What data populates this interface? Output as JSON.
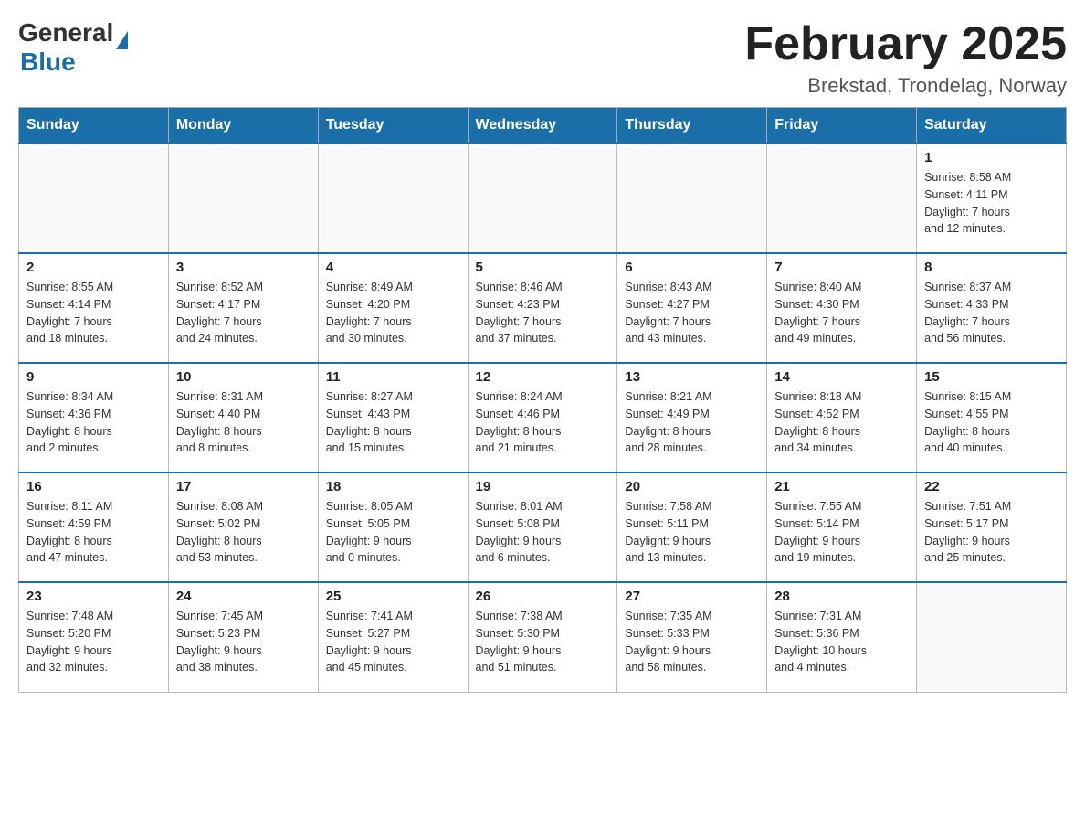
{
  "header": {
    "logo_general": "General",
    "logo_blue": "Blue",
    "month_title": "February 2025",
    "location": "Brekstad, Trondelag, Norway"
  },
  "weekdays": [
    "Sunday",
    "Monday",
    "Tuesday",
    "Wednesday",
    "Thursday",
    "Friday",
    "Saturday"
  ],
  "weeks": [
    [
      {
        "day": "",
        "info": ""
      },
      {
        "day": "",
        "info": ""
      },
      {
        "day": "",
        "info": ""
      },
      {
        "day": "",
        "info": ""
      },
      {
        "day": "",
        "info": ""
      },
      {
        "day": "",
        "info": ""
      },
      {
        "day": "1",
        "info": "Sunrise: 8:58 AM\nSunset: 4:11 PM\nDaylight: 7 hours\nand 12 minutes."
      }
    ],
    [
      {
        "day": "2",
        "info": "Sunrise: 8:55 AM\nSunset: 4:14 PM\nDaylight: 7 hours\nand 18 minutes."
      },
      {
        "day": "3",
        "info": "Sunrise: 8:52 AM\nSunset: 4:17 PM\nDaylight: 7 hours\nand 24 minutes."
      },
      {
        "day": "4",
        "info": "Sunrise: 8:49 AM\nSunset: 4:20 PM\nDaylight: 7 hours\nand 30 minutes."
      },
      {
        "day": "5",
        "info": "Sunrise: 8:46 AM\nSunset: 4:23 PM\nDaylight: 7 hours\nand 37 minutes."
      },
      {
        "day": "6",
        "info": "Sunrise: 8:43 AM\nSunset: 4:27 PM\nDaylight: 7 hours\nand 43 minutes."
      },
      {
        "day": "7",
        "info": "Sunrise: 8:40 AM\nSunset: 4:30 PM\nDaylight: 7 hours\nand 49 minutes."
      },
      {
        "day": "8",
        "info": "Sunrise: 8:37 AM\nSunset: 4:33 PM\nDaylight: 7 hours\nand 56 minutes."
      }
    ],
    [
      {
        "day": "9",
        "info": "Sunrise: 8:34 AM\nSunset: 4:36 PM\nDaylight: 8 hours\nand 2 minutes."
      },
      {
        "day": "10",
        "info": "Sunrise: 8:31 AM\nSunset: 4:40 PM\nDaylight: 8 hours\nand 8 minutes."
      },
      {
        "day": "11",
        "info": "Sunrise: 8:27 AM\nSunset: 4:43 PM\nDaylight: 8 hours\nand 15 minutes."
      },
      {
        "day": "12",
        "info": "Sunrise: 8:24 AM\nSunset: 4:46 PM\nDaylight: 8 hours\nand 21 minutes."
      },
      {
        "day": "13",
        "info": "Sunrise: 8:21 AM\nSunset: 4:49 PM\nDaylight: 8 hours\nand 28 minutes."
      },
      {
        "day": "14",
        "info": "Sunrise: 8:18 AM\nSunset: 4:52 PM\nDaylight: 8 hours\nand 34 minutes."
      },
      {
        "day": "15",
        "info": "Sunrise: 8:15 AM\nSunset: 4:55 PM\nDaylight: 8 hours\nand 40 minutes."
      }
    ],
    [
      {
        "day": "16",
        "info": "Sunrise: 8:11 AM\nSunset: 4:59 PM\nDaylight: 8 hours\nand 47 minutes."
      },
      {
        "day": "17",
        "info": "Sunrise: 8:08 AM\nSunset: 5:02 PM\nDaylight: 8 hours\nand 53 minutes."
      },
      {
        "day": "18",
        "info": "Sunrise: 8:05 AM\nSunset: 5:05 PM\nDaylight: 9 hours\nand 0 minutes."
      },
      {
        "day": "19",
        "info": "Sunrise: 8:01 AM\nSunset: 5:08 PM\nDaylight: 9 hours\nand 6 minutes."
      },
      {
        "day": "20",
        "info": "Sunrise: 7:58 AM\nSunset: 5:11 PM\nDaylight: 9 hours\nand 13 minutes."
      },
      {
        "day": "21",
        "info": "Sunrise: 7:55 AM\nSunset: 5:14 PM\nDaylight: 9 hours\nand 19 minutes."
      },
      {
        "day": "22",
        "info": "Sunrise: 7:51 AM\nSunset: 5:17 PM\nDaylight: 9 hours\nand 25 minutes."
      }
    ],
    [
      {
        "day": "23",
        "info": "Sunrise: 7:48 AM\nSunset: 5:20 PM\nDaylight: 9 hours\nand 32 minutes."
      },
      {
        "day": "24",
        "info": "Sunrise: 7:45 AM\nSunset: 5:23 PM\nDaylight: 9 hours\nand 38 minutes."
      },
      {
        "day": "25",
        "info": "Sunrise: 7:41 AM\nSunset: 5:27 PM\nDaylight: 9 hours\nand 45 minutes."
      },
      {
        "day": "26",
        "info": "Sunrise: 7:38 AM\nSunset: 5:30 PM\nDaylight: 9 hours\nand 51 minutes."
      },
      {
        "day": "27",
        "info": "Sunrise: 7:35 AM\nSunset: 5:33 PM\nDaylight: 9 hours\nand 58 minutes."
      },
      {
        "day": "28",
        "info": "Sunrise: 7:31 AM\nSunset: 5:36 PM\nDaylight: 10 hours\nand 4 minutes."
      },
      {
        "day": "",
        "info": ""
      }
    ]
  ]
}
